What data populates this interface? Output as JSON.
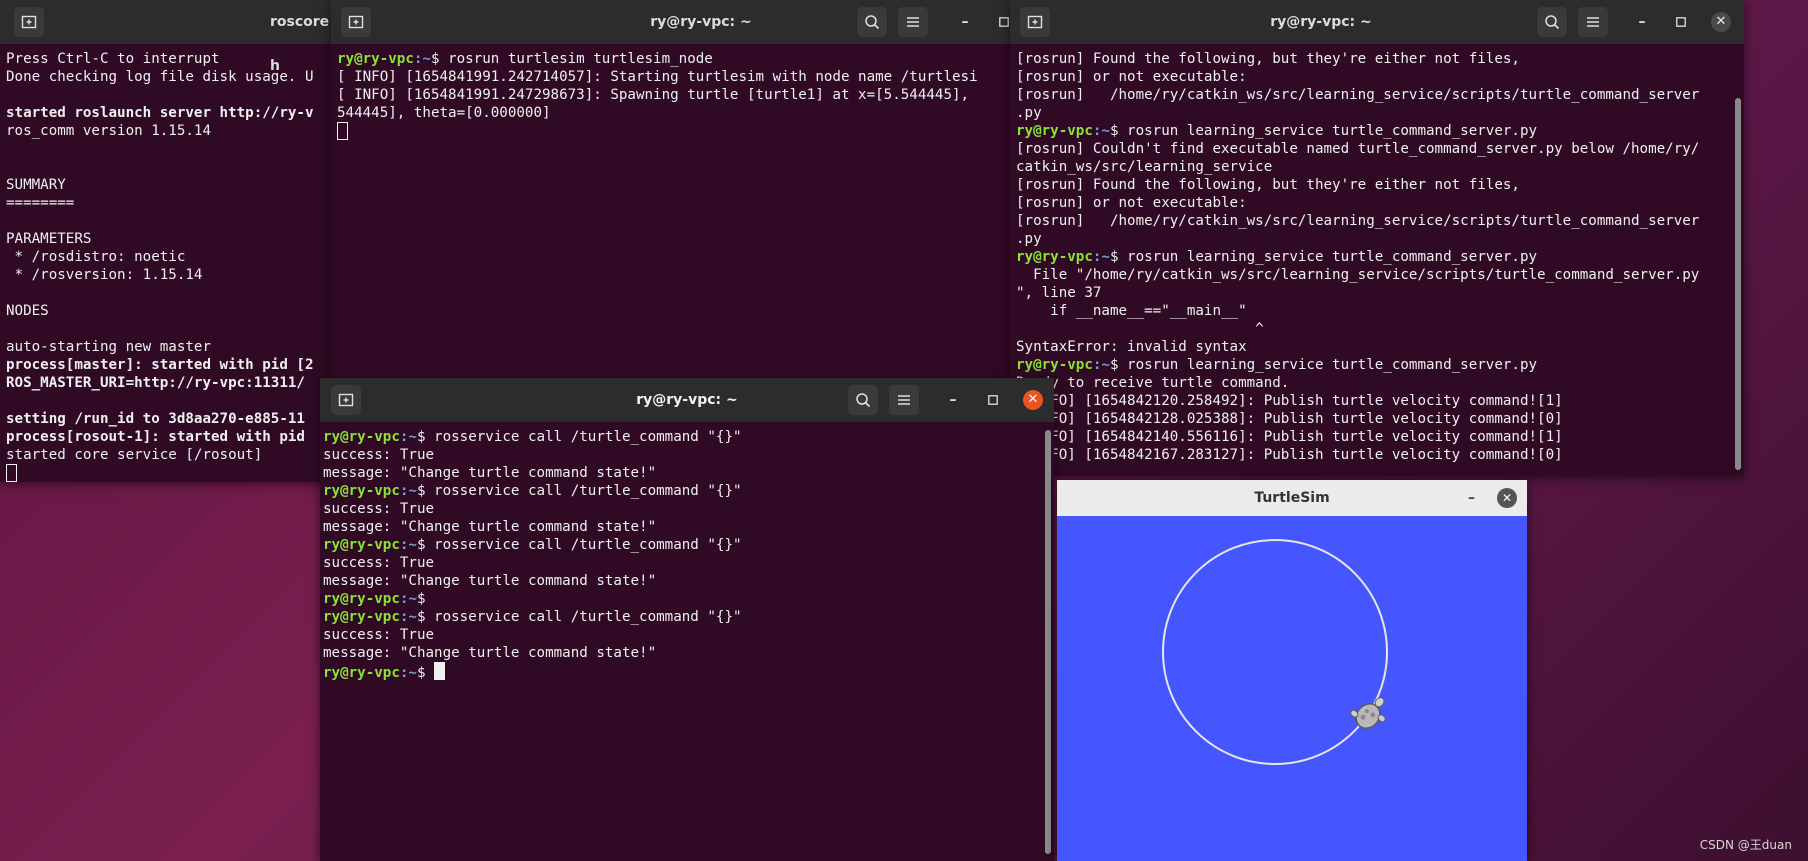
{
  "roscore_window": {
    "title": "roscore h",
    "lines": [
      {
        "text": "Press Ctrl-C to interrupt",
        "bold": false
      },
      {
        "text": "Done checking log file disk usage. U",
        "bold": false
      },
      {
        "text": "",
        "bold": false
      },
      {
        "text": "started roslaunch server http://ry-v",
        "bold": true
      },
      {
        "text": "ros_comm version 1.15.14",
        "bold": false
      },
      {
        "text": "",
        "bold": false
      },
      {
        "text": "",
        "bold": false
      },
      {
        "text": "SUMMARY",
        "bold": false
      },
      {
        "text": "========",
        "bold": false
      },
      {
        "text": "",
        "bold": false
      },
      {
        "text": "PARAMETERS",
        "bold": false
      },
      {
        "text": " * /rosdistro: noetic",
        "bold": false
      },
      {
        "text": " * /rosversion: 1.15.14",
        "bold": false
      },
      {
        "text": "",
        "bold": false
      },
      {
        "text": "NODES",
        "bold": false
      },
      {
        "text": "",
        "bold": false
      },
      {
        "text": "auto-starting new master",
        "bold": false
      },
      {
        "text": "process[master]: started with pid [2",
        "bold": true
      },
      {
        "text": "ROS_MASTER_URI=http://ry-vpc:11311/",
        "bold": true
      },
      {
        "text": "",
        "bold": false
      },
      {
        "text": "setting /run_id to 3d8aa270-e885-11",
        "bold": true
      },
      {
        "text": "process[rosout-1]: started with pid",
        "bold": true
      },
      {
        "text": "started core service [/rosout]",
        "bold": false
      }
    ]
  },
  "turtlesim_node_window": {
    "title": "ry@ry-vpc: ~",
    "lines": [
      {
        "prompt": true,
        "user": "ry@ry-vpc",
        "path": ":~",
        "cmd": "$ rosrun turtlesim turtlesim_node"
      },
      {
        "prompt": false,
        "text": "[ INFO] [1654841991.242714057]: Starting turtlesim with node name /turtlesi"
      },
      {
        "prompt": false,
        "text": "[ INFO] [1654841991.247298673]: Spawning turtle [turtle1] at x=[5.544445], "
      },
      {
        "prompt": false,
        "text": "544445], theta=[0.000000]"
      }
    ]
  },
  "server_window": {
    "title": "ry@ry-vpc: ~",
    "lines": [
      {
        "prompt": false,
        "text": "[rosrun] Found the following, but they're either not files,"
      },
      {
        "prompt": false,
        "text": "[rosrun] or not executable:"
      },
      {
        "prompt": false,
        "text": "[rosrun]   /home/ry/catkin_ws/src/learning_service/scripts/turtle_command_server"
      },
      {
        "prompt": false,
        "text": ".py"
      },
      {
        "prompt": true,
        "user": "ry@ry-vpc",
        "path": ":~",
        "cmd": "$ rosrun learning_service turtle_command_server.py"
      },
      {
        "prompt": false,
        "text": "[rosrun] Couldn't find executable named turtle_command_server.py below /home/ry/"
      },
      {
        "prompt": false,
        "text": "catkin_ws/src/learning_service"
      },
      {
        "prompt": false,
        "text": "[rosrun] Found the following, but they're either not files,"
      },
      {
        "prompt": false,
        "text": "[rosrun] or not executable:"
      },
      {
        "prompt": false,
        "text": "[rosrun]   /home/ry/catkin_ws/src/learning_service/scripts/turtle_command_server"
      },
      {
        "prompt": false,
        "text": ".py"
      },
      {
        "prompt": true,
        "user": "ry@ry-vpc",
        "path": ":~",
        "cmd": "$ rosrun learning_service turtle_command_server.py"
      },
      {
        "prompt": false,
        "text": "  File \"/home/ry/catkin_ws/src/learning_service/scripts/turtle_command_server.py"
      },
      {
        "prompt": false,
        "text": "\", line 37"
      },
      {
        "prompt": false,
        "text": "    if __name__==\"__main__\""
      },
      {
        "prompt": false,
        "text": "                            ^"
      },
      {
        "prompt": false,
        "text": "SyntaxError: invalid syntax"
      },
      {
        "prompt": true,
        "user": "ry@ry-vpc",
        "path": ":~",
        "cmd": "$ rosrun learning_service turtle_command_server.py"
      },
      {
        "prompt": false,
        "text": "Ready to receive turtle command."
      },
      {
        "prompt": false,
        "text": "[ INFO] [1654842120.258492]: Publish turtle velocity command![1]"
      },
      {
        "prompt": false,
        "text": "[ INFO] [1654842128.025388]: Publish turtle velocity command![0]"
      },
      {
        "prompt": false,
        "text": "[ INFO] [1654842140.556116]: Publish turtle velocity command![1]"
      },
      {
        "prompt": false,
        "text": "[ INFO] [1654842167.283127]: Publish turtle velocity command![0]"
      }
    ]
  },
  "client_window": {
    "title": "ry@ry-vpc: ~",
    "lines": [
      {
        "prompt": true,
        "user": "ry@ry-vpc",
        "path": ":~",
        "cmd": "$ rosservice call /turtle_command \"{}\""
      },
      {
        "prompt": false,
        "text": "success: True"
      },
      {
        "prompt": false,
        "text": "message: \"Change turtle command state!\""
      },
      {
        "prompt": true,
        "user": "ry@ry-vpc",
        "path": ":~",
        "cmd": "$ rosservice call /turtle_command \"{}\""
      },
      {
        "prompt": false,
        "text": "success: True"
      },
      {
        "prompt": false,
        "text": "message: \"Change turtle command state!\""
      },
      {
        "prompt": true,
        "user": "ry@ry-vpc",
        "path": ":~",
        "cmd": "$ rosservice call /turtle_command \"{}\""
      },
      {
        "prompt": false,
        "text": "success: True"
      },
      {
        "prompt": false,
        "text": "message: \"Change turtle command state!\""
      },
      {
        "prompt": true,
        "user": "ry@ry-vpc",
        "path": ":~",
        "cmd": "$"
      },
      {
        "prompt": true,
        "user": "ry@ry-vpc",
        "path": ":~",
        "cmd": "$ rosservice call /turtle_command \"{}\""
      },
      {
        "prompt": false,
        "text": "success: True"
      },
      {
        "prompt": false,
        "text": "message: \"Change turtle command state!\""
      },
      {
        "prompt": true,
        "user": "ry@ry-vpc",
        "path": ":~",
        "cmd": "$ "
      }
    ]
  },
  "turtlesim_window": {
    "title": "TurtleSim",
    "background": "#4556ff",
    "path_color": "#e6e6e6"
  },
  "icons": {
    "new_tab": "new-tab-icon",
    "search": "search-icon",
    "menu": "hamburger-menu-icon",
    "minimize": "minimize-icon",
    "maximize": "maximize-icon",
    "close": "close-icon"
  },
  "colors": {
    "terminal_bg": "#300a24",
    "prompt_user": "#8ae234",
    "prompt_path": "#729fcf",
    "close_active": "#e95420"
  },
  "watermark": "CSDN @王duan"
}
